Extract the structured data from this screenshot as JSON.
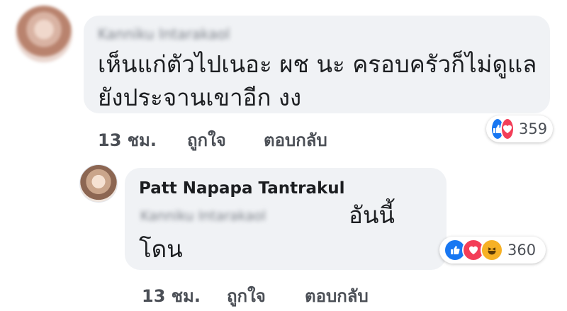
{
  "comments": [
    {
      "author_blurred": "Kanniku Intarakaol",
      "text_line1": "เห็นแก่ตัวไปเนอะ ผช นะ ครอบครัวก็ไม่ดูแล",
      "text_line2": "ยังประจานเขาอีก งง",
      "time": "13 ชม.",
      "like_label": "ถูกใจ",
      "reply_label": "ตอบกลับ",
      "reactions": [
        "like",
        "love"
      ],
      "reaction_count": "359"
    },
    {
      "author": "Patt Napapa Tantrakul",
      "mention_blurred": "Kanniku Intarakaol",
      "text_after_mention": "อันนี้",
      "text_line2": "โดน",
      "time": "13 ชม.",
      "like_label": "ถูกใจ",
      "reply_label": "ตอบกลับ",
      "reactions": [
        "like",
        "love",
        "haha"
      ],
      "reaction_count": "360"
    }
  ]
}
